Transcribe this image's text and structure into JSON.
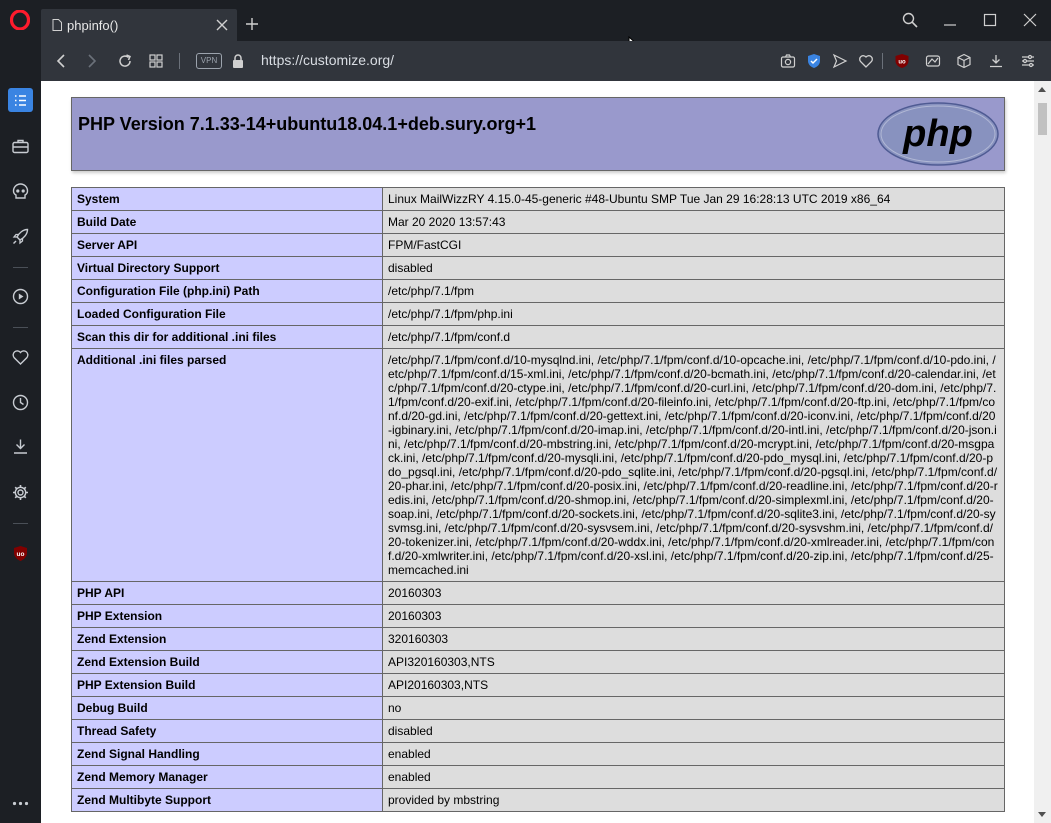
{
  "browser": {
    "tab_title": "phpinfo()",
    "url": "https://customize.org/",
    "vpn_label": "VPN"
  },
  "page": {
    "php_version_title": "PHP Version 7.1.33-14+ubuntu18.04.1+deb.sury.org+1",
    "logo_text": "php",
    "rows": [
      {
        "label": "System",
        "value": "Linux MailWizzRY 4.15.0-45-generic #48-Ubuntu SMP Tue Jan 29 16:28:13 UTC 2019 x86_64"
      },
      {
        "label": "Build Date",
        "value": "Mar 20 2020 13:57:43"
      },
      {
        "label": "Server API",
        "value": "FPM/FastCGI"
      },
      {
        "label": "Virtual Directory Support",
        "value": "disabled"
      },
      {
        "label": "Configuration File (php.ini) Path",
        "value": "/etc/php/7.1/fpm"
      },
      {
        "label": "Loaded Configuration File",
        "value": "/etc/php/7.1/fpm/php.ini"
      },
      {
        "label": "Scan this dir for additional .ini files",
        "value": "/etc/php/7.1/fpm/conf.d"
      },
      {
        "label": "Additional .ini files parsed",
        "value": "/etc/php/7.1/fpm/conf.d/10-mysqlnd.ini, /etc/php/7.1/fpm/conf.d/10-opcache.ini, /etc/php/7.1/fpm/conf.d/10-pdo.ini, /etc/php/7.1/fpm/conf.d/15-xml.ini, /etc/php/7.1/fpm/conf.d/20-bcmath.ini, /etc/php/7.1/fpm/conf.d/20-calendar.ini, /etc/php/7.1/fpm/conf.d/20-ctype.ini, /etc/php/7.1/fpm/conf.d/20-curl.ini, /etc/php/7.1/fpm/conf.d/20-dom.ini, /etc/php/7.1/fpm/conf.d/20-exif.ini, /etc/php/7.1/fpm/conf.d/20-fileinfo.ini, /etc/php/7.1/fpm/conf.d/20-ftp.ini, /etc/php/7.1/fpm/conf.d/20-gd.ini, /etc/php/7.1/fpm/conf.d/20-gettext.ini, /etc/php/7.1/fpm/conf.d/20-iconv.ini, /etc/php/7.1/fpm/conf.d/20-igbinary.ini, /etc/php/7.1/fpm/conf.d/20-imap.ini, /etc/php/7.1/fpm/conf.d/20-intl.ini, /etc/php/7.1/fpm/conf.d/20-json.ini, /etc/php/7.1/fpm/conf.d/20-mbstring.ini, /etc/php/7.1/fpm/conf.d/20-mcrypt.ini, /etc/php/7.1/fpm/conf.d/20-msgpack.ini, /etc/php/7.1/fpm/conf.d/20-mysqli.ini, /etc/php/7.1/fpm/conf.d/20-pdo_mysql.ini, /etc/php/7.1/fpm/conf.d/20-pdo_pgsql.ini, /etc/php/7.1/fpm/conf.d/20-pdo_sqlite.ini, /etc/php/7.1/fpm/conf.d/20-pgsql.ini, /etc/php/7.1/fpm/conf.d/20-phar.ini, /etc/php/7.1/fpm/conf.d/20-posix.ini, /etc/php/7.1/fpm/conf.d/20-readline.ini, /etc/php/7.1/fpm/conf.d/20-redis.ini, /etc/php/7.1/fpm/conf.d/20-shmop.ini, /etc/php/7.1/fpm/conf.d/20-simplexml.ini, /etc/php/7.1/fpm/conf.d/20-soap.ini, /etc/php/7.1/fpm/conf.d/20-sockets.ini, /etc/php/7.1/fpm/conf.d/20-sqlite3.ini, /etc/php/7.1/fpm/conf.d/20-sysvmsg.ini, /etc/php/7.1/fpm/conf.d/20-sysvsem.ini, /etc/php/7.1/fpm/conf.d/20-sysvshm.ini, /etc/php/7.1/fpm/conf.d/20-tokenizer.ini, /etc/php/7.1/fpm/conf.d/20-wddx.ini, /etc/php/7.1/fpm/conf.d/20-xmlreader.ini, /etc/php/7.1/fpm/conf.d/20-xmlwriter.ini, /etc/php/7.1/fpm/conf.d/20-xsl.ini, /etc/php/7.1/fpm/conf.d/20-zip.ini, /etc/php/7.1/fpm/conf.d/25-memcached.ini"
      },
      {
        "label": "PHP API",
        "value": "20160303"
      },
      {
        "label": "PHP Extension",
        "value": "20160303"
      },
      {
        "label": "Zend Extension",
        "value": "320160303"
      },
      {
        "label": "Zend Extension Build",
        "value": "API320160303,NTS"
      },
      {
        "label": "PHP Extension Build",
        "value": "API20160303,NTS"
      },
      {
        "label": "Debug Build",
        "value": "no"
      },
      {
        "label": "Thread Safety",
        "value": "disabled"
      },
      {
        "label": "Zend Signal Handling",
        "value": "enabled"
      },
      {
        "label": "Zend Memory Manager",
        "value": "enabled"
      },
      {
        "label": "Zend Multibyte Support",
        "value": "provided by mbstring"
      }
    ]
  },
  "colors": {
    "header_bg": "#9999cc",
    "label_bg": "#ccccff",
    "value_bg": "#dddddd",
    "opera_red": "#ff1b2d",
    "sidebar_active": "#3a84e2"
  }
}
